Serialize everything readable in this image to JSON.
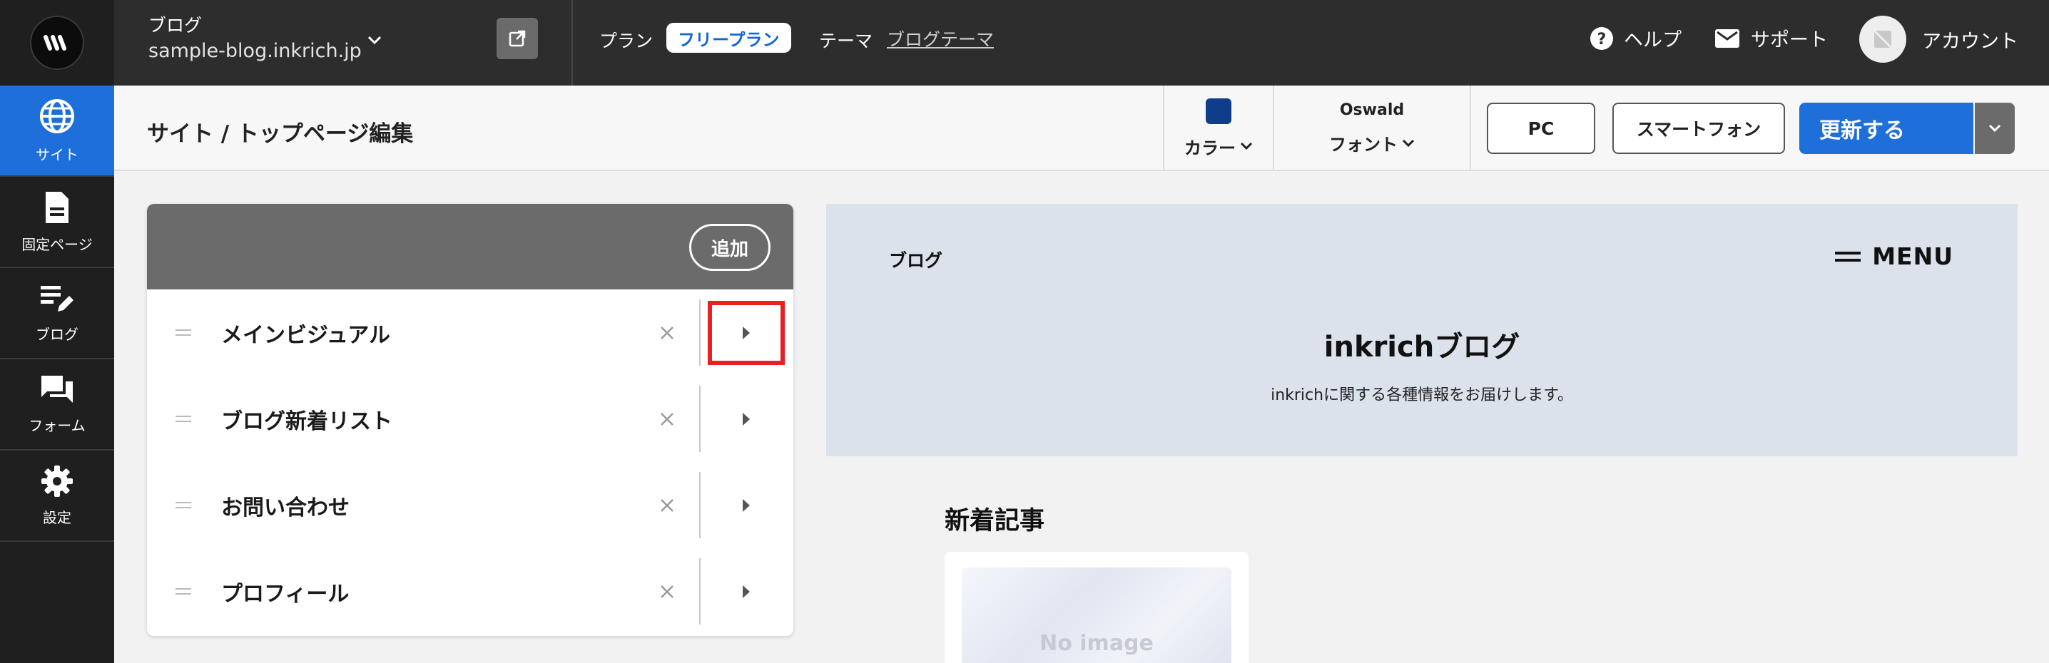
{
  "topbar": {
    "site_name": "ブログ",
    "site_url": "sample-blog.inkrich.jp",
    "plan_label": "プラン",
    "plan_value": "フリープラン",
    "theme_label": "テーマ",
    "theme_value": "ブログテーマ",
    "help": "ヘルプ",
    "support": "サポート",
    "account": "アカウント"
  },
  "sidebar": {
    "items": [
      {
        "label": "サイト",
        "icon": "globe-icon",
        "active": true
      },
      {
        "label": "固定ページ",
        "icon": "document-icon",
        "active": false
      },
      {
        "label": "ブログ",
        "icon": "edit-list-icon",
        "active": false
      },
      {
        "label": "フォーム",
        "icon": "chat-icon",
        "active": false
      },
      {
        "label": "設定",
        "icon": "gear-icon",
        "active": false
      }
    ]
  },
  "subheader": {
    "breadcrumb": "サイト / トップページ編集",
    "color_label": "カラー",
    "color_value": "#0f3d8a",
    "font_value": "Oswald",
    "font_label": "フォント",
    "pc_label": "PC",
    "smartphone_label": "スマートフォン",
    "update_label": "更新する"
  },
  "sections": {
    "add_label": "追加",
    "items": [
      {
        "label": "メインビジュアル",
        "highlighted": true
      },
      {
        "label": "ブログ新着リスト",
        "highlighted": false
      },
      {
        "label": "お問い合わせ",
        "highlighted": false
      },
      {
        "label": "プロフィール",
        "highlighted": false
      }
    ]
  },
  "preview": {
    "site_name": "ブログ",
    "menu_label": "MENU",
    "title": "inkrichブログ",
    "description": "inkrichに関する各種情報をお届けします。",
    "news_heading": "新着記事",
    "card_placeholder": "No image"
  },
  "colors": {
    "accent": "#1e6fd9",
    "highlight": "#e82020",
    "topbar_bg": "#2d2d2d",
    "hero_bg": "#dbe2ec"
  }
}
